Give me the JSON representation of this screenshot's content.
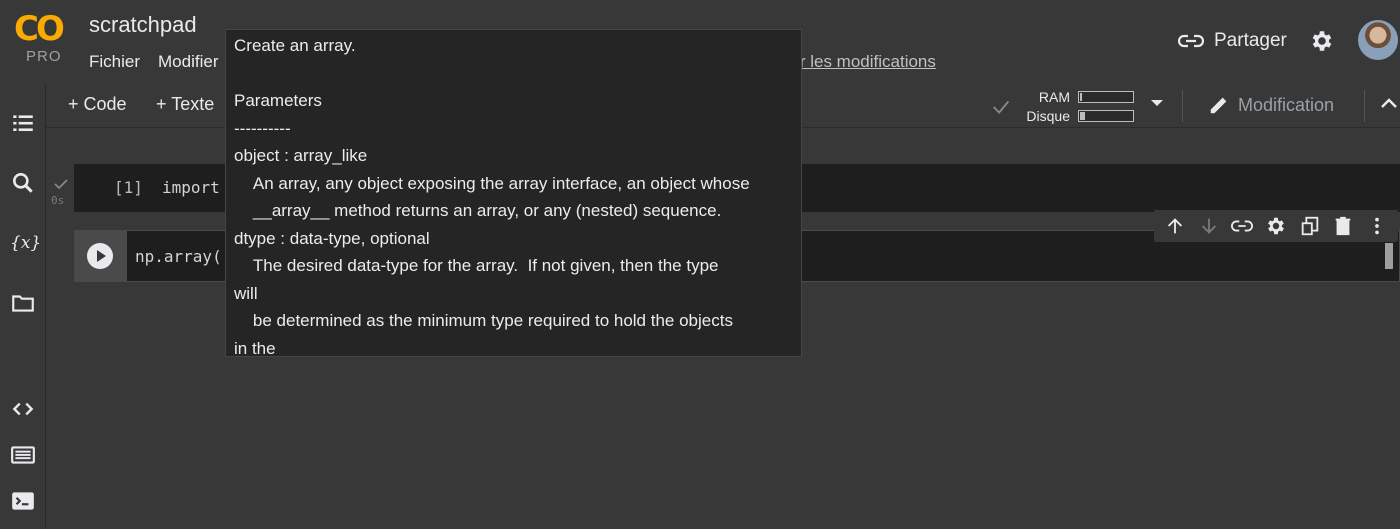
{
  "app": {
    "logo_text": "CO",
    "logo_badge": "PRO",
    "title": "scratchpad",
    "menu": [
      "Fichier",
      "Modifier"
    ],
    "save_link": "trer les modifications"
  },
  "header_right": {
    "share_label": "Partager",
    "share_icon": "link-icon",
    "settings_icon": "gear-icon"
  },
  "toolbar": {
    "add_code": "+ Code",
    "add_text": "+ Texte",
    "ram_label": "RAM",
    "disk_label": "Disque",
    "ram_fraction": 0.02,
    "disk_fraction": 0.1,
    "edit_label": "Modification"
  },
  "sidebar": {
    "icons": [
      "toc-icon",
      "search-icon",
      "variables-icon",
      "folder-icon",
      "code-snippets-icon",
      "command-palette-icon",
      "terminal-icon"
    ],
    "variables_glyph": "{x}"
  },
  "cells": [
    {
      "prompt": "[1]",
      "code": "import nu",
      "exec_time": "0s"
    },
    {
      "code": "np.array("
    }
  ],
  "cell_toolbar": {
    "icons": [
      "arrow-up-icon",
      "arrow-down-icon",
      "link-icon",
      "gear-icon",
      "mirror-cell-icon",
      "delete-icon",
      "more-vert-icon"
    ]
  },
  "tooltip": {
    "text": "Create an array.\n\nParameters\n----------\nobject : array_like\n    An array, any object exposing the array interface, an object whose\n    __array__ method returns an array, or any (nested) sequence.\ndtype : data-type, optional\n    The desired data-type for the array.  If not given, then the type\nwill\n    be determined as the minimum type required to hold the objects\nin the"
  },
  "colors": {
    "logo_orange": "#f9ab00",
    "background": "#383838",
    "editor": "#1e1e1e",
    "tooltip_bg": "#252526"
  }
}
